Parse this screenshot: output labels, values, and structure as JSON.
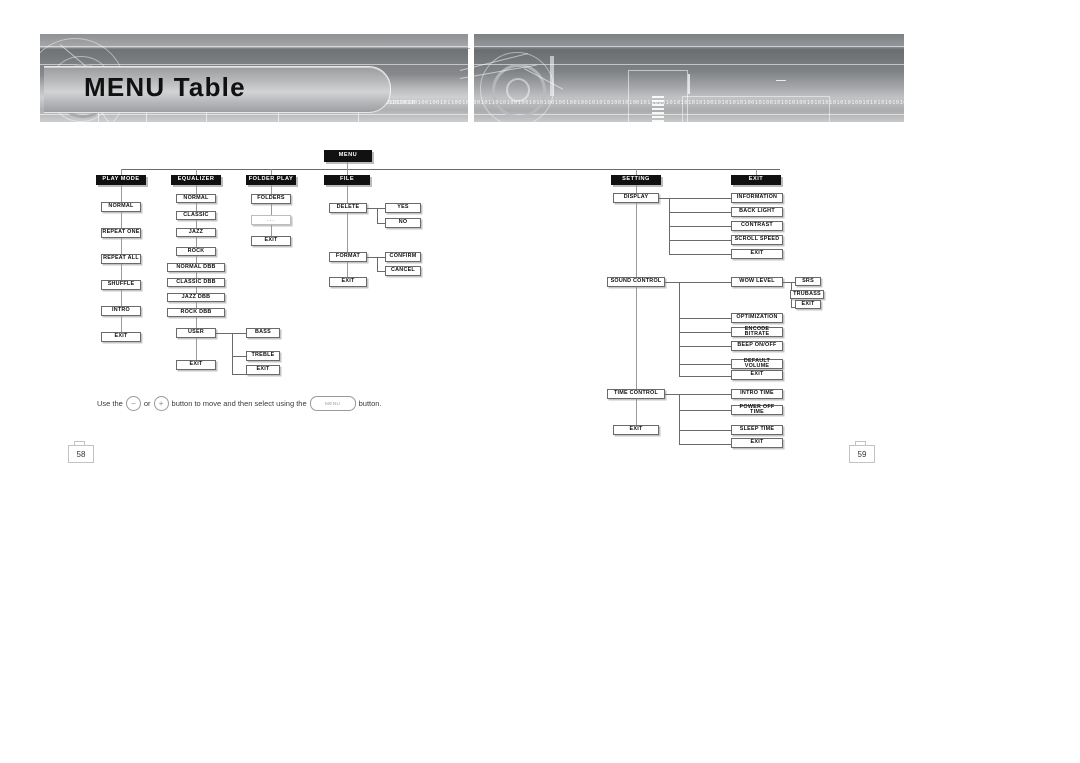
{
  "header": {
    "title": "MENU Table",
    "binary_strip": "0101100101001011010100100101010010010010010101010010101001001001010100101010010101001010100100101010100101001010010101001010010100101001010010100101001010010100101",
    "binary_strip_right": "010110101010101010100101010101001010010101010010101010101010010101010101001010010101010100101010101001010101010"
  },
  "diagram": {
    "root": {
      "label": "MENU"
    },
    "columns": [
      {
        "header": "PLAY MODE",
        "items": [
          "NORMAL",
          "REPEAT ONE",
          "REPEAT ALL",
          "SHUFFLE",
          "INTRO",
          "EXIT"
        ]
      },
      {
        "header": "EQUALIZER",
        "items": [
          "NORMAL",
          "CLASSIC",
          "JAZZ",
          "ROCK",
          "NORMAL DBB",
          "CLASSIC DBB",
          "JAZZ DBB",
          "ROCK DBB",
          "USER",
          "EXIT"
        ],
        "sub": {
          "parent": "USER",
          "items": [
            "BASS",
            "TREBLE",
            "EXIT"
          ]
        }
      },
      {
        "header": "FOLDER PLAY",
        "items": [
          "FOLDERS",
          "...",
          "EXIT"
        ]
      },
      {
        "header": "FILE",
        "items": [
          "DELETE",
          "FORMAT",
          "EXIT"
        ],
        "branches": [
          {
            "parent": "DELETE",
            "items": [
              "YES",
              "NO"
            ]
          },
          {
            "parent": "FORMAT",
            "items": [
              "CONFIRM",
              "CANCEL"
            ]
          }
        ]
      },
      {
        "header": "SETTING",
        "items": [
          "DISPLAY",
          "SOUND CONTROL",
          "TIME CONTROL",
          "EXIT"
        ],
        "branches": [
          {
            "parent": "DISPLAY",
            "items": [
              "INFORMATION",
              "BACK LIGHT",
              "CONTRAST",
              "SCROLL SPEED",
              "EXIT"
            ]
          },
          {
            "parent": "SOUND CONTROL",
            "items": [
              "WOW LEVEL",
              "OPTIMIZATION",
              "ENCODE BITRATE",
              "BEEP ON/OFF",
              "DEFAULT VOLUME",
              "EXIT"
            ]
          },
          {
            "parent": "TIME CONTROL",
            "items": [
              "INTRO TIME",
              "POWER OFF TIME",
              "SLEEP TIME",
              "EXIT"
            ]
          }
        ],
        "subsub": {
          "parent": "WOW LEVEL",
          "items": [
            "SRS",
            "TRUBASS",
            "EXIT"
          ]
        }
      },
      {
        "header": "EXIT",
        "items": []
      }
    ]
  },
  "caption": {
    "part1": "Use the",
    "minus": "−",
    "part2": "or",
    "plus": "+",
    "part3": "button to move and then select using the",
    "menu_button": "MENU",
    "part4": "button."
  },
  "pages": {
    "left": "58",
    "right": "59"
  },
  "colors": {
    "header_box": "#111111",
    "box_border": "#6a6a6a",
    "connector": "#9a9a9a"
  }
}
